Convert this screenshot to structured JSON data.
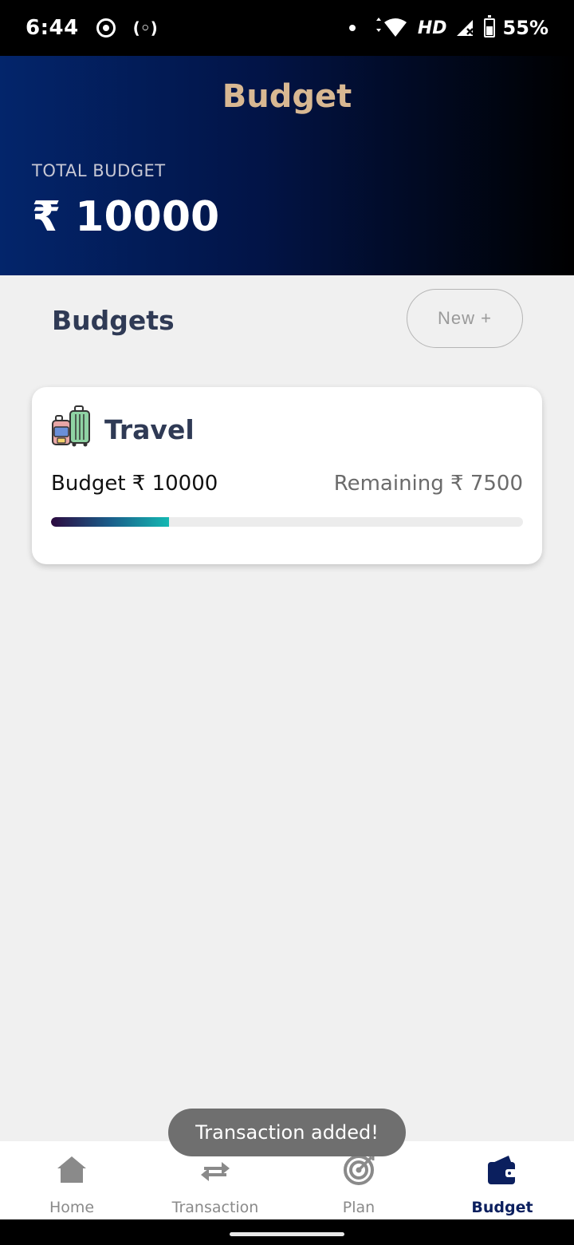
{
  "status_bar": {
    "time": "6:44",
    "hd": "HD",
    "battery": "55%",
    "icons": [
      "screen-record-icon",
      "hotspot-icon",
      "notification-dot-icon",
      "data-arrows-icon",
      "wifi-icon",
      "signal-icon",
      "battery-icon"
    ]
  },
  "header": {
    "title": "Budget",
    "total_label": "TOTAL BUDGET",
    "total_amount": "₹ 10000"
  },
  "section": {
    "title": "Budgets",
    "new_button": "New +"
  },
  "budgets": [
    {
      "name": "Travel",
      "icon": "luggage-icon",
      "budget_text": "Budget ₹ 10000",
      "remaining_text": "Remaining ₹ 7500",
      "spent_fraction": 0.25
    }
  ],
  "toast": "Transaction added!",
  "nav": [
    {
      "label": "Home",
      "icon": "home-icon",
      "active": false
    },
    {
      "label": "Transaction",
      "icon": "transfer-arrows-icon",
      "active": false
    },
    {
      "label": "Plan",
      "icon": "target-icon",
      "active": false
    },
    {
      "label": "Budget",
      "icon": "wallet-icon",
      "active": true
    }
  ],
  "colors": {
    "header_start": "#03256b",
    "header_end": "#000000",
    "title_gold": "#d8b892",
    "active_nav": "#0b1f5e",
    "progress_start": "#2c0a3f",
    "progress_end": "#14b8b2"
  }
}
